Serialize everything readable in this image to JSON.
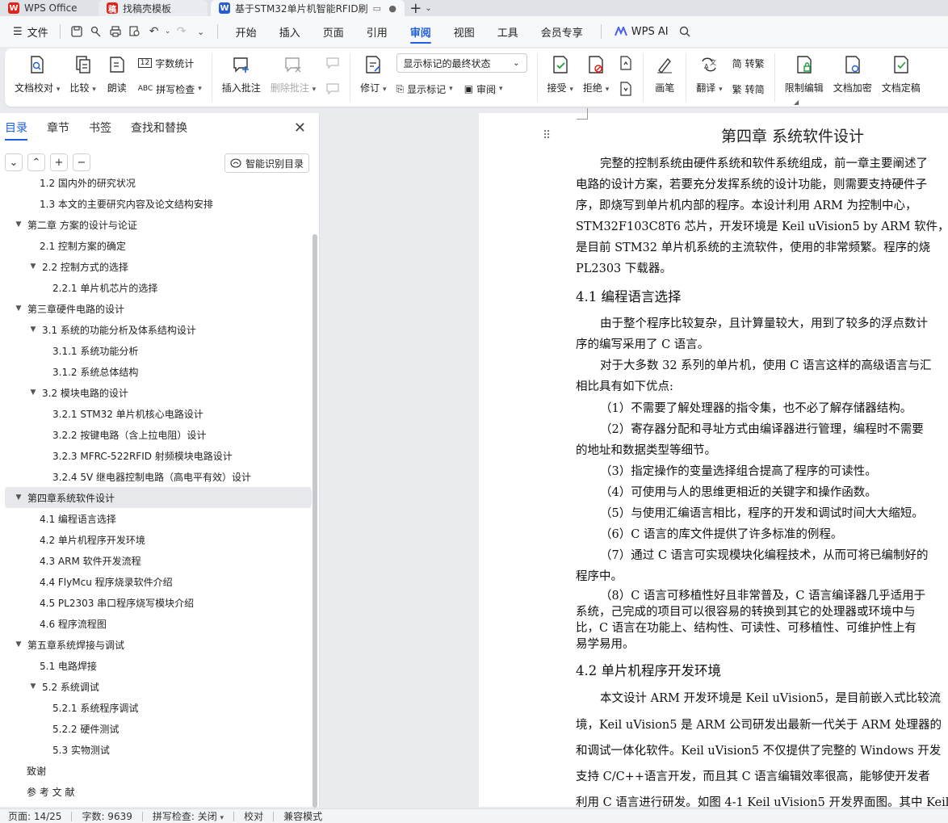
{
  "tabs": [
    {
      "label": "WPS Office"
    },
    {
      "label": "找稿壳模板"
    },
    {
      "label": "基于STM32单片机智能RFID刷"
    }
  ],
  "menubar": {
    "file": "文件",
    "items": [
      "开始",
      "插入",
      "页面",
      "引用",
      "审阅",
      "视图",
      "工具",
      "会员专享"
    ],
    "active": "审阅",
    "wps_ai": "WPS AI"
  },
  "ribbon": {
    "doc_check": "文档校对",
    "compare": "比较",
    "read_aloud": "朗读",
    "word_count": "字数统计",
    "spell_check": "拼写检查",
    "insert_comment": "插入批注",
    "delete_comment": "删除批注",
    "track_changes": "修订",
    "markup_state": "显示标记的最终状态",
    "show_markup": "显示标记",
    "review": "审阅",
    "accept": "接受",
    "reject": "拒绝",
    "pen": "画笔",
    "translate": "翻译",
    "to_traditional": "转繁",
    "to_simplified": "转简",
    "restrict_edit": "限制编辑",
    "encrypt": "文档加密",
    "finalize": "文档定稿"
  },
  "nav": {
    "tabs": [
      "目录",
      "章节",
      "书签",
      "查找和替换"
    ],
    "smart_toc": "智能识别目录",
    "toc": [
      {
        "level": 2,
        "text": "1.2 国内外的研究状况",
        "arrow": false
      },
      {
        "level": 2,
        "text": "1.3 本文的主要研究内容及论文结构安排",
        "arrow": false
      },
      {
        "level": 1,
        "text": "第二章  方案的设计与论证",
        "arrow": true
      },
      {
        "level": 2,
        "text": "2.1 控制方案的确定",
        "arrow": false
      },
      {
        "level": 2,
        "text": "2.2 控制方式的选择",
        "arrow": true
      },
      {
        "level": 3,
        "text": "2.2.1  单片机芯片的选择",
        "arrow": false
      },
      {
        "level": 1,
        "text": "第三章硬件电路的设计",
        "arrow": true
      },
      {
        "level": 2,
        "text": "3.1 系统的功能分析及体系结构设计",
        "arrow": true
      },
      {
        "level": 3,
        "text": "3.1.1 系统功能分析",
        "arrow": false
      },
      {
        "level": 3,
        "text": "3.1.2 系统总体结构",
        "arrow": false
      },
      {
        "level": 2,
        "text": "3.2 模块电路的设计",
        "arrow": true
      },
      {
        "level": 3,
        "text": "3.2.1 STM32 单片机核心电路设计",
        "arrow": false
      },
      {
        "level": 3,
        "text": "3.2.2  按键电路（含上拉电阻）设计",
        "arrow": false
      },
      {
        "level": 3,
        "text": "3.2.3 MFRC-522RFID 射频模块电路设计",
        "arrow": false
      },
      {
        "level": 3,
        "text": "3.2.4 5V 继电器控制电路（高电平有效）设计",
        "arrow": false
      },
      {
        "level": 1,
        "text": "第四章系统软件设计",
        "arrow": true,
        "selected": true
      },
      {
        "level": 2,
        "text": "4.1  编程语言选择",
        "arrow": false
      },
      {
        "level": 2,
        "text": "4.2 单片机程序开发环境",
        "arrow": false
      },
      {
        "level": 2,
        "text": "4.3 ARM 软件开发流程",
        "arrow": false
      },
      {
        "level": 2,
        "text": "4.4 FlyMcu 程序烧录软件介绍",
        "arrow": false
      },
      {
        "level": 2,
        "text": "4.5 PL2303 串口程序烧写模块介绍",
        "arrow": false
      },
      {
        "level": 2,
        "text": "4.6  程序流程图",
        "arrow": false
      },
      {
        "level": 1,
        "text": "第五章系统焊接与调试",
        "arrow": true
      },
      {
        "level": 2,
        "text": "5.1  电路焊接",
        "arrow": false
      },
      {
        "level": 2,
        "text": "5.2  系统调试",
        "arrow": true
      },
      {
        "level": 3,
        "text": "5.2.1  系统程序调试",
        "arrow": false
      },
      {
        "level": 3,
        "text": "5.2.2 硬件测试",
        "arrow": false
      },
      {
        "level": 3,
        "text": "5.3  实物测试",
        "arrow": false
      },
      {
        "level": 1,
        "text": "致谢",
        "arrow": false
      },
      {
        "level": 1,
        "text": "参 考 文 献",
        "arrow": false
      }
    ]
  },
  "doc": {
    "heading": "第四章  系统软件设计",
    "lines": [
      "完整的控制系统由硬件系统和软件系统组成，前一章主要阐述了",
      "电路的设计方案，若要充分发挥系统的设计功能，则需要支持硬件子",
      "序，即烧写到单片机内部的程序。本设计利用 ARM 为控制中心，",
      "STM32F103C8T6 芯片，开发环境是 Keil uVision5 by ARM 软件，这",
      "是目前 STM32 单片机系统的主流软件，使用的非常频繁。程序的烧",
      "PL2303 下载器。"
    ],
    "h41": "4.1  编程语言选择",
    "lines2": [
      "由于整个程序比较复杂，且计算量较大，用到了较多的浮点数计",
      "序的编写采用了 C 语言。",
      "对于大多数 32 系列的单片机，使用 C 语言这样的高级语言与汇",
      "相比具有如下优点:",
      "（1）不需要了解处理器的指令集，也不必了解存储器结构。",
      "（2）寄存器分配和寻址方式由编译器进行管理，编程时不需要",
      "的地址和数据类型等细节。",
      "（3）指定操作的变量选择组合提高了程序的可读性。",
      "（4）可使用与人的思维更相近的关键字和操作函数。",
      "（5）与使用汇编语言相比，程序的开发和调试时间大大缩短。",
      "（6）C 语言的库文件提供了许多标准的例程。",
      "（7）通过 C 语言可实现模块化编程技术，从而可将已编制好的",
      "程序中。",
      "（8）C 语言可移植性好且非常普及，C 语言编译器几乎适用于",
      "系统，己完成的项目可以很容易的转换到其它的处理器或环境中与",
      "比，C 语言在功能上、结构性、可读性、可移植性、可维护性上有",
      "易学易用。"
    ],
    "h42": "4.2 单片机程序开发环境",
    "lines3": [
      "本文设计 ARM 开发环境是 Keil uVision5，是目前嵌入式比较流",
      "境，Keil uVision5 是 ARM 公司研发出最新一代关于 ARM 处理器的",
      "和调试一体化软件。Keil uVision5 不仅提供了完整的 Windows 开发",
      "支持 C/C++语言开发，而且其 C 语言编辑效率很高，能够使开发者",
      "利用 C 语言进行研发。如图 4-1 Keil uVision5 开发界面图。其中 Keil"
    ]
  },
  "status": {
    "page": "页面: 14/25",
    "words": "字数: 9639",
    "spell": "拼写检查: 关闭",
    "proof": "校对",
    "compat": "兼容模式"
  }
}
